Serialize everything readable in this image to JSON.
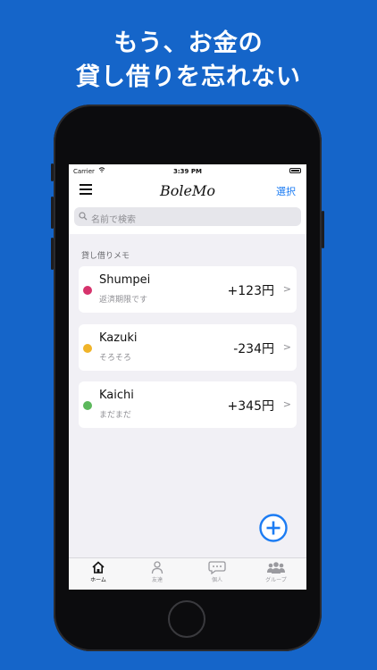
{
  "headline": {
    "line1": "もう、お金の",
    "line2": "貸し借りを忘れない"
  },
  "status_bar": {
    "carrier": "Carrier",
    "time": "3:39 PM"
  },
  "nav": {
    "title": "BoleMo",
    "select_label": "選択"
  },
  "search": {
    "placeholder": "名前で検索"
  },
  "section": {
    "header": "貸し借りメモ"
  },
  "entries": [
    {
      "name": "Shumpei",
      "note": "返済期限です",
      "amount": "+123円",
      "dot_color": "#d6336c"
    },
    {
      "name": "Kazuki",
      "note": "そろそろ",
      "amount": "-234円",
      "dot_color": "#f0b429"
    },
    {
      "name": "Kaichi",
      "note": "まだまだ",
      "amount": "+345円",
      "dot_color": "#5cb85c"
    }
  ],
  "tabs": [
    {
      "label": "ホーム",
      "icon": "home-icon"
    },
    {
      "label": "友達",
      "icon": "person-icon"
    },
    {
      "label": "個人",
      "icon": "chat-icon"
    },
    {
      "label": "グループ",
      "icon": "group-icon"
    }
  ],
  "colors": {
    "background": "#1565c9",
    "accent": "#1c7cf3"
  }
}
